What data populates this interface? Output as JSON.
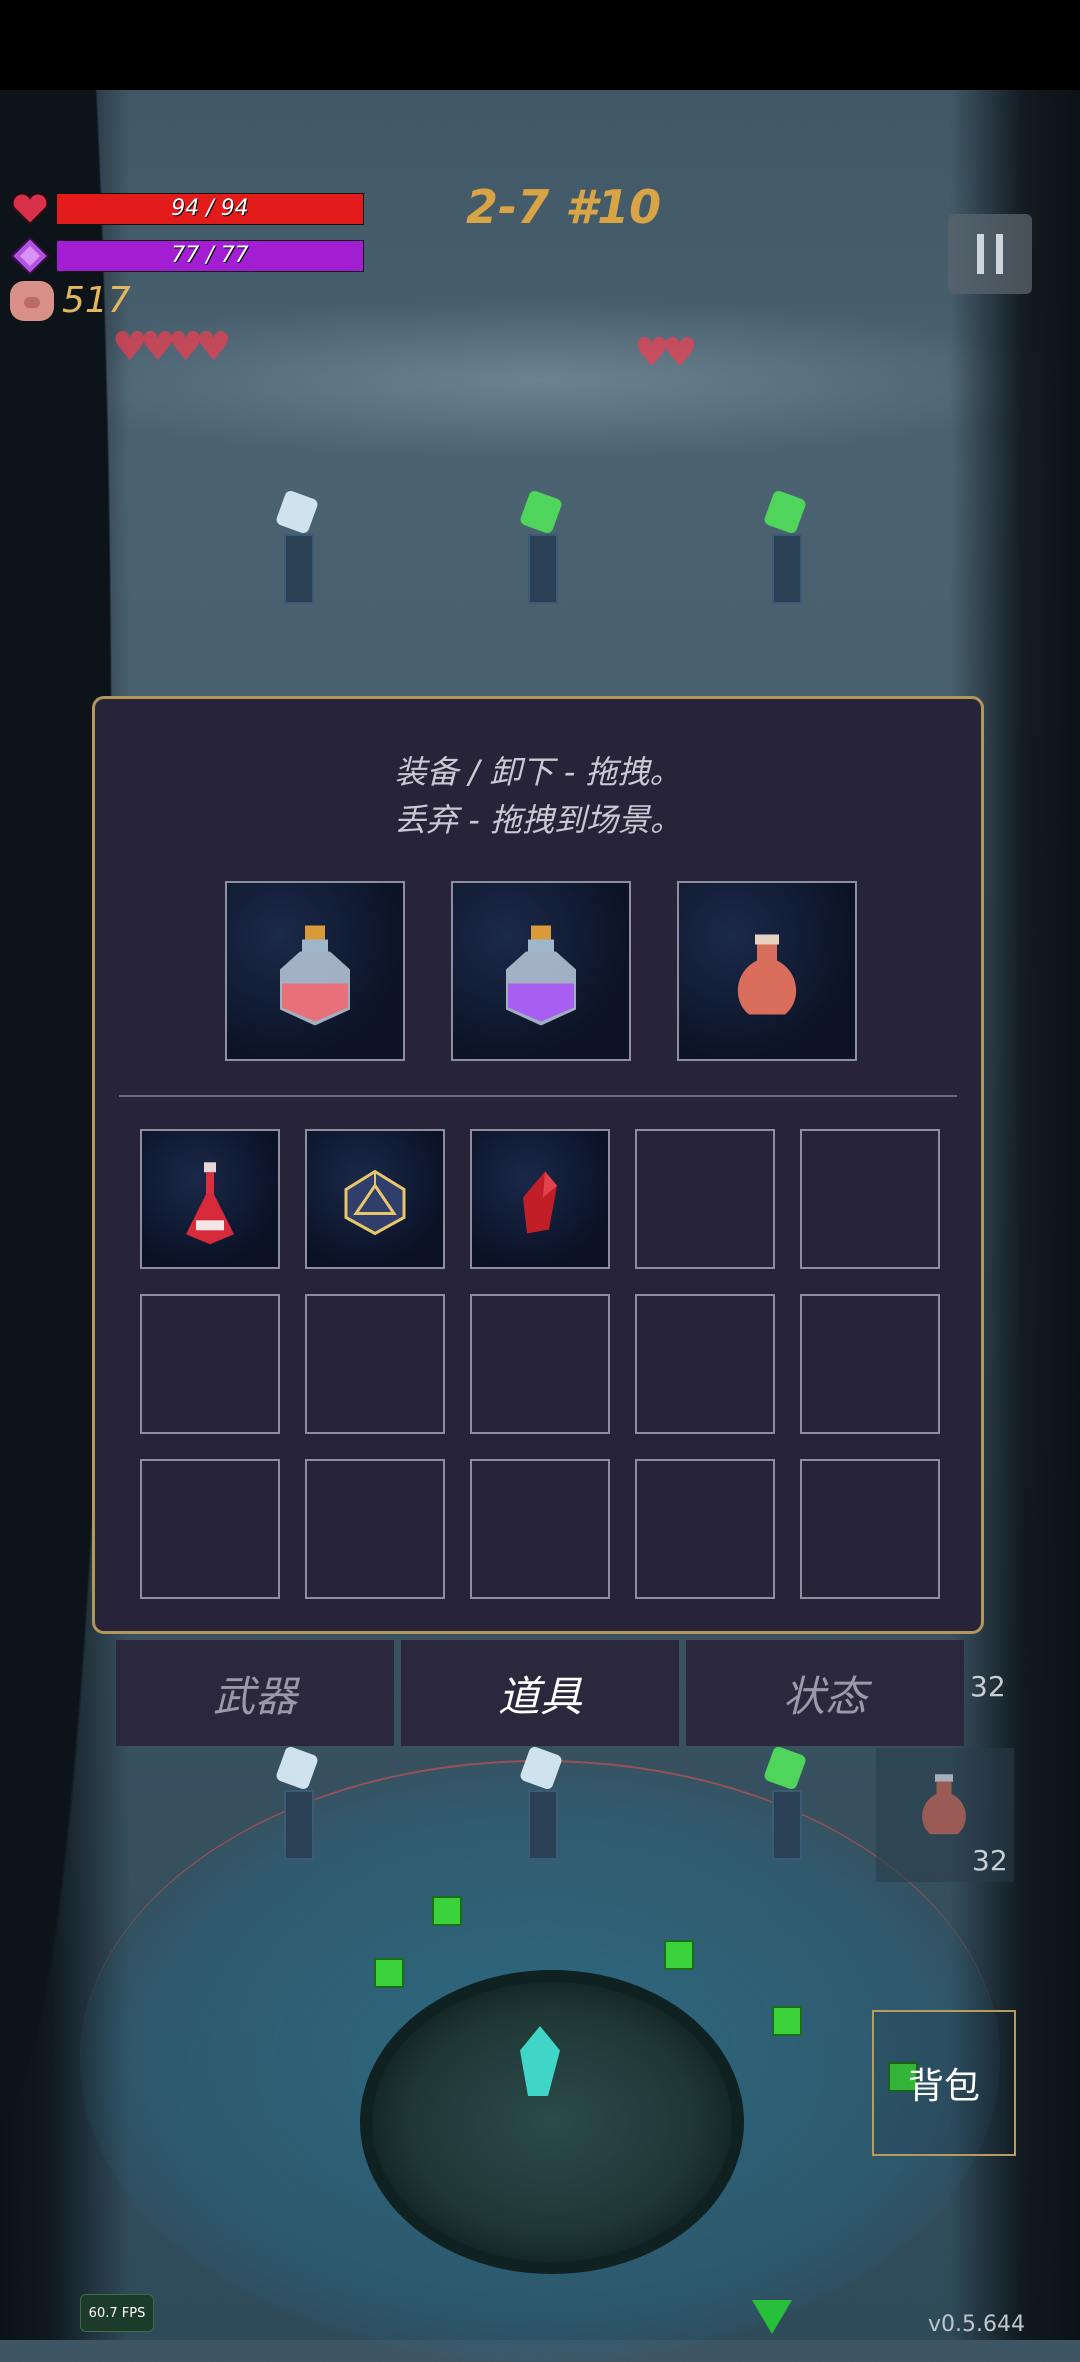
{
  "hud": {
    "hp_text": "94 / 94",
    "hp_fraction": 1.0,
    "mp_text": "77 / 77",
    "mp_fraction": 1.0,
    "coins": "517",
    "level": "2-7 #10",
    "colors": {
      "hp": "#e31b1b",
      "mp": "#a11ed2",
      "coins": "#e4b75d",
      "level": "#d8a445"
    }
  },
  "inventory_panel": {
    "hint_line1": "装备 / 卸下 - 拖拽。",
    "hint_line2": "丢弃 - 拖拽到场景。",
    "equipped": [
      {
        "icon": "red-potion-bottle-icon"
      },
      {
        "icon": "purple-potion-bottle-icon"
      },
      {
        "icon": "clay-vase-icon"
      }
    ],
    "items": [
      {
        "icon": "red-flask-icon"
      },
      {
        "icon": "icosahedron-gem-icon"
      },
      {
        "icon": "red-crystal-icon"
      }
    ]
  },
  "tabs": {
    "weapons": "武器",
    "items": "道具",
    "status": "状态",
    "active": "items"
  },
  "scene": {
    "bag_label": "背包",
    "side_count_1": "32",
    "side_count_2": "32",
    "fps": "60.7 FPS",
    "version": "v0.5.644"
  }
}
